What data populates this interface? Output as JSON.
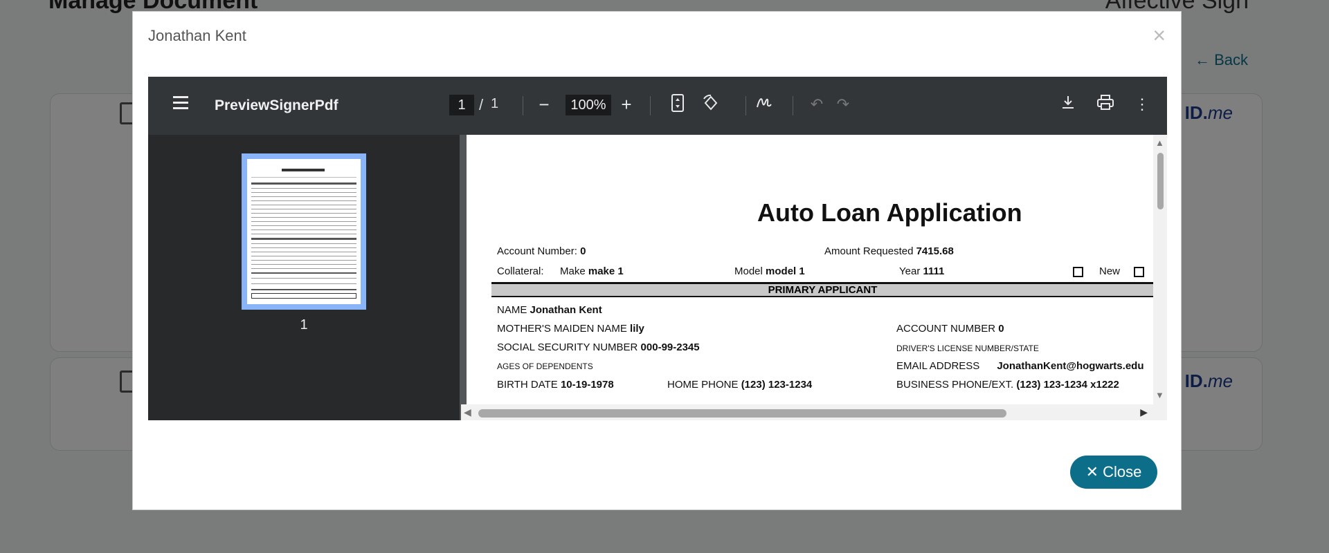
{
  "background": {
    "page_title": "Manage Document",
    "brand": "Affective Sign",
    "back_label": "← Back",
    "idme_prefix": "ID.",
    "idme_suffix": "me"
  },
  "modal": {
    "title": "Jonathan Kent",
    "close_x": "×",
    "close_button": "Close"
  },
  "viewer": {
    "file_name": "PreviewSignerPdf",
    "current_page": "1",
    "page_separator": "/",
    "total_pages": "1",
    "zoom": "100%",
    "thumbnail_label": "1"
  },
  "document": {
    "title": "Auto Loan Application",
    "account_number_label": "Account Number:",
    "account_number": "0",
    "amount_requested_label": "Amount Requested",
    "amount_requested": "7415.68",
    "collateral_label": "Collateral:",
    "make_label": "Make",
    "make": "make 1",
    "model_label": "Model",
    "model": "model 1",
    "year_label": "Year",
    "year": "1111",
    "new_label": "New",
    "section": "PRIMARY APPLICANT",
    "name_label": "NAME",
    "name": "Jonathan Kent",
    "maiden_label": "MOTHER'S MAIDEN NAME",
    "maiden": "lily",
    "acct_label": "ACCOUNT NUMBER",
    "acct": "0",
    "ssn_label": "SOCIAL SECURITY NUMBER",
    "ssn": "000-99-2345",
    "dl_label": "DRIVER'S LICENSE NUMBER/STATE",
    "ages_label": "AGES OF DEPENDENTS",
    "email_label": "EMAIL ADDRESS",
    "email": "JonathanKent@hogwarts.edu",
    "birth_label": "BIRTH DATE",
    "birth": "10-19-1978",
    "home_phone_label": "HOME PHONE",
    "home_phone": "(123) 123-1234",
    "business_phone_label": "BUSINESS PHONE/EXT.",
    "business_phone": "(123) 123-1234 x1222"
  },
  "colors": {
    "accent": "#0d6e8a",
    "toolbar": "#323639",
    "thumbnail_highlight": "#8ab4f8"
  }
}
